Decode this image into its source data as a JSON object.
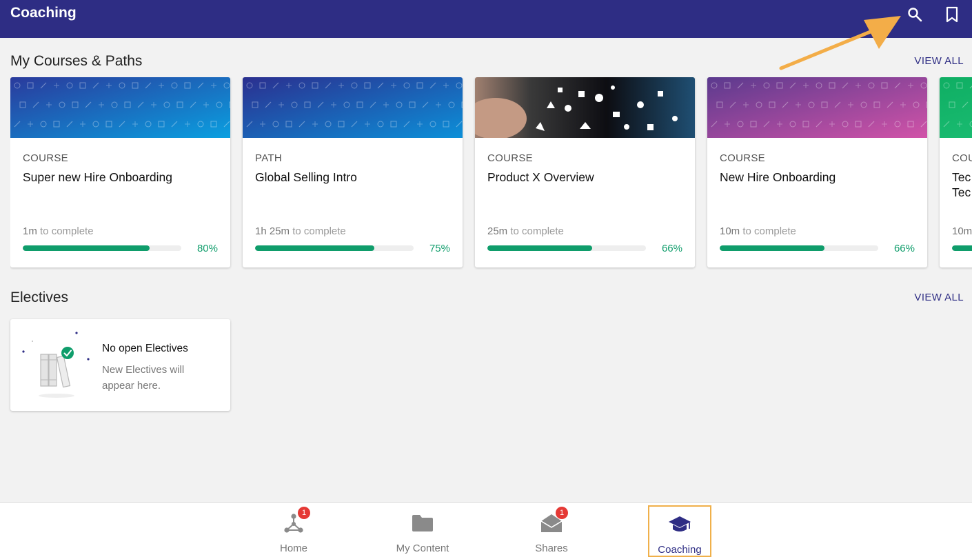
{
  "appbar": {
    "title": "Coaching",
    "search_icon": "search-icon",
    "bookmark_icon": "bookmark-icon",
    "color": "#2e2d84"
  },
  "courses_section": {
    "title": "My Courses & Paths",
    "view_all": "VIEW ALL",
    "cards": [
      {
        "type": "COURSE",
        "title": "Super new Hire Onboarding",
        "duration": "1m",
        "duration_suffix": " to complete",
        "percent_label": "80%",
        "progress": 0.8,
        "banner": "blue"
      },
      {
        "type": "PATH",
        "title": "Global Selling Intro",
        "duration": "1h 25m",
        "duration_suffix": " to complete",
        "percent_label": "75%",
        "progress": 0.75,
        "banner": "indigo"
      },
      {
        "type": "COURSE",
        "title": "Product X Overview",
        "duration": "25m",
        "duration_suffix": " to complete",
        "percent_label": "66%",
        "progress": 0.66,
        "banner": "photo"
      },
      {
        "type": "COURSE",
        "title": "New Hire Onboarding",
        "duration": "10m",
        "duration_suffix": " to complete",
        "percent_label": "66%",
        "progress": 0.66,
        "banner": "purple"
      },
      {
        "type": "COU",
        "title": "Tec Tec",
        "duration": "10m",
        "duration_suffix": "",
        "percent_label": "",
        "progress": 0.66,
        "banner": "green"
      }
    ]
  },
  "electives_section": {
    "title": "Electives",
    "view_all": "VIEW ALL",
    "empty_title": "No open Electives",
    "empty_subtitle": "New Electives will appear here."
  },
  "bottom_nav": {
    "items": [
      {
        "label": "Home",
        "icon": "network-icon",
        "badge": "1"
      },
      {
        "label": "My Content",
        "icon": "folder-icon",
        "badge": ""
      },
      {
        "label": "Shares",
        "icon": "open-mail-icon",
        "badge": "1"
      },
      {
        "label": "Coaching",
        "icon": "graduation-cap-icon",
        "badge": ""
      }
    ],
    "active": "Coaching"
  },
  "colors": {
    "accent": "#2e2d84",
    "progress": "#0f9d6b",
    "badge": "#e53935",
    "highlight": "#f0b04a"
  }
}
